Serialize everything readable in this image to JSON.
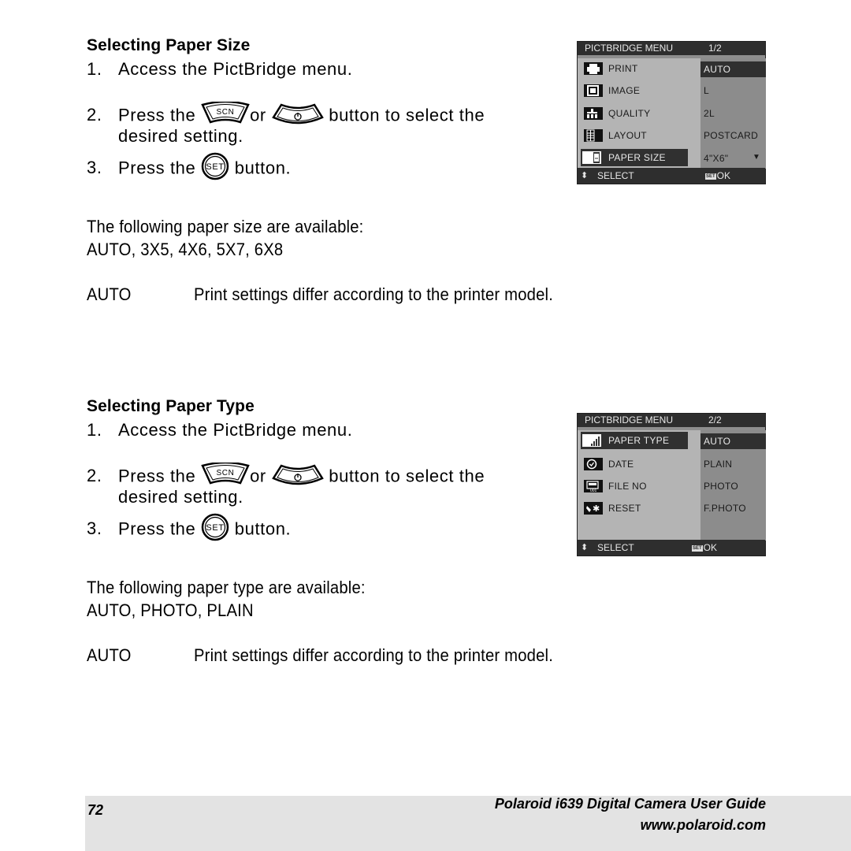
{
  "sections": [
    {
      "heading": "Selecting Paper Size",
      "steps": [
        {
          "num": "1.",
          "text": "Access the PictBridge menu."
        },
        {
          "num": "2.",
          "pre": "Press the",
          "mid": "or",
          "post": "button to select the",
          "cont": "desired setting."
        },
        {
          "num": "3.",
          "pre": "Press the",
          "post": "button."
        }
      ],
      "available_intro": "The following paper size are available:",
      "available_list": "AUTO, 3X5, 4X6, 5X7, 6X8",
      "note_term": "AUTO",
      "note_desc": "Print settings differ according to the printer model.",
      "lcd": {
        "title": "PICTBRIDGE MENU",
        "page": "1/2",
        "items": [
          {
            "label": "PRINT",
            "icon": "printer-icon"
          },
          {
            "label": "IMAGE",
            "icon": "image-icon"
          },
          {
            "label": "QUALITY",
            "icon": "quality-icon"
          },
          {
            "label": "LAYOUT",
            "icon": "layout-icon"
          },
          {
            "label": "PAPER SIZE",
            "icon": "paper-size-icon",
            "selected": true
          }
        ],
        "values": [
          "AUTO",
          "L",
          "2L",
          "POSTCARD",
          "4\"X6\""
        ],
        "selected_value": "AUTO",
        "more_indicator": "▼",
        "footer_left": "SELECT",
        "footer_badge": "SET",
        "footer_right": "OK"
      }
    },
    {
      "heading": "Selecting Paper Type",
      "steps": [
        {
          "num": "1.",
          "text": "Access the PictBridge menu."
        },
        {
          "num": "2.",
          "pre": "Press the",
          "mid": "or",
          "post": "button to select the",
          "cont": "desired setting."
        },
        {
          "num": "3.",
          "pre": "Press the",
          "post": "button."
        }
      ],
      "available_intro": "The following paper type are available:",
      "available_list": "AUTO, PHOTO, PLAIN",
      "note_term": "AUTO",
      "note_desc": "Print settings differ according to the printer model.",
      "lcd": {
        "title": "PICTBRIDGE MENU",
        "page": "2/2",
        "items": [
          {
            "label": "PAPER TYPE",
            "icon": "paper-type-icon",
            "selected": true
          },
          {
            "label": "DATE",
            "icon": "date-icon"
          },
          {
            "label": "FILE NO",
            "icon": "file-no-icon"
          },
          {
            "label": "RESET",
            "icon": "reset-icon"
          }
        ],
        "values": [
          "AUTO",
          "PLAIN",
          "PHOTO",
          "F.PHOTO"
        ],
        "selected_value": "AUTO",
        "footer_left": "SELECT",
        "footer_badge": "SET",
        "footer_right": "OK"
      }
    }
  ],
  "buttons": {
    "scn": "SCN",
    "set": "SET"
  },
  "footer": {
    "page_number": "72",
    "title": "Polaroid i639 Digital Camera User Guide",
    "url": "www.polaroid.com"
  }
}
